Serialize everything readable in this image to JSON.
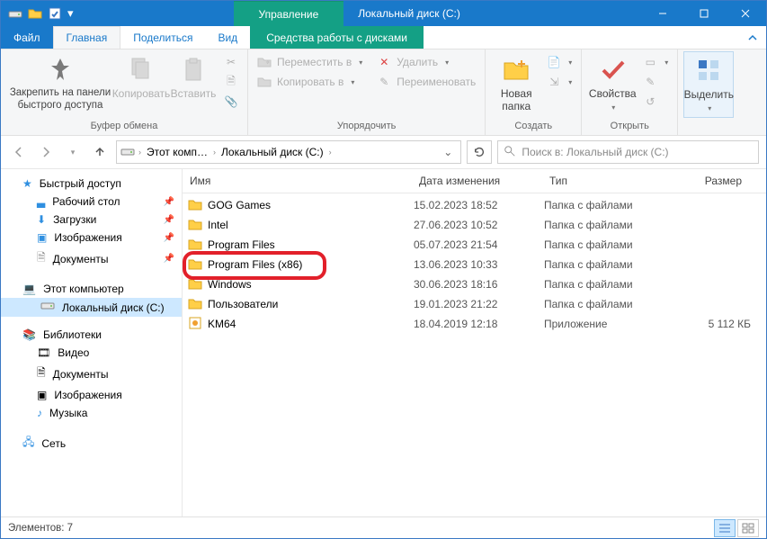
{
  "title": {
    "context_tab": "Управление",
    "window": "Локальный диск (C:)"
  },
  "menu": {
    "file": "Файл",
    "home": "Главная",
    "share": "Поделиться",
    "view": "Вид",
    "drive_tools": "Средства работы с дисками"
  },
  "ribbon": {
    "clipboard": {
      "pin": "Закрепить на панели быстрого доступа",
      "copy": "Копировать",
      "paste": "Вставить",
      "label": "Буфер обмена"
    },
    "organize": {
      "move": "Переместить в",
      "copy_to": "Копировать в",
      "delete": "Удалить",
      "rename": "Переименовать",
      "label": "Упорядочить"
    },
    "new": {
      "new_folder": "Новая папка",
      "label": "Создать"
    },
    "open": {
      "properties": "Свойства",
      "label": "Открыть"
    },
    "select": {
      "select": "Выделить",
      "label": ""
    }
  },
  "address": {
    "root": "Этот комп…",
    "current": "Локальный диск (C:)"
  },
  "search": {
    "placeholder": "Поиск в: Локальный диск (C:)"
  },
  "nav": {
    "quick": "Быстрый доступ",
    "desktop": "Рабочий стол",
    "downloads": "Загрузки",
    "pictures": "Изображения",
    "documents": "Документы",
    "this_pc": "Этот компьютер",
    "local_disk": "Локальный диск (C:)",
    "libraries": "Библиотеки",
    "videos": "Видео",
    "documents2": "Документы",
    "pictures2": "Изображения",
    "music": "Музыка",
    "network": "Сеть"
  },
  "columns": {
    "name": "Имя",
    "date": "Дата изменения",
    "type": "Тип",
    "size": "Размер"
  },
  "rows": [
    {
      "name": "GOG Games",
      "date": "15.02.2023 18:52",
      "type": "Папка с файлами",
      "size": "",
      "kind": "folder"
    },
    {
      "name": "Intel",
      "date": "27.06.2023 10:52",
      "type": "Папка с файлами",
      "size": "",
      "kind": "folder"
    },
    {
      "name": "Program Files",
      "date": "05.07.2023 21:54",
      "type": "Папка с файлами",
      "size": "",
      "kind": "folder"
    },
    {
      "name": "Program Files (x86)",
      "date": "13.06.2023 10:33",
      "type": "Папка с файлами",
      "size": "",
      "kind": "folder",
      "highlighted": true
    },
    {
      "name": "Windows",
      "date": "30.06.2023 18:16",
      "type": "Папка с файлами",
      "size": "",
      "kind": "folder"
    },
    {
      "name": "Пользователи",
      "date": "19.01.2023 21:22",
      "type": "Папка с файлами",
      "size": "",
      "kind": "folder"
    },
    {
      "name": "KM64",
      "date": "18.04.2019 12:18",
      "type": "Приложение",
      "size": "5 112 КБ",
      "kind": "app"
    }
  ],
  "status": {
    "count_label": "Элементов: 7"
  }
}
